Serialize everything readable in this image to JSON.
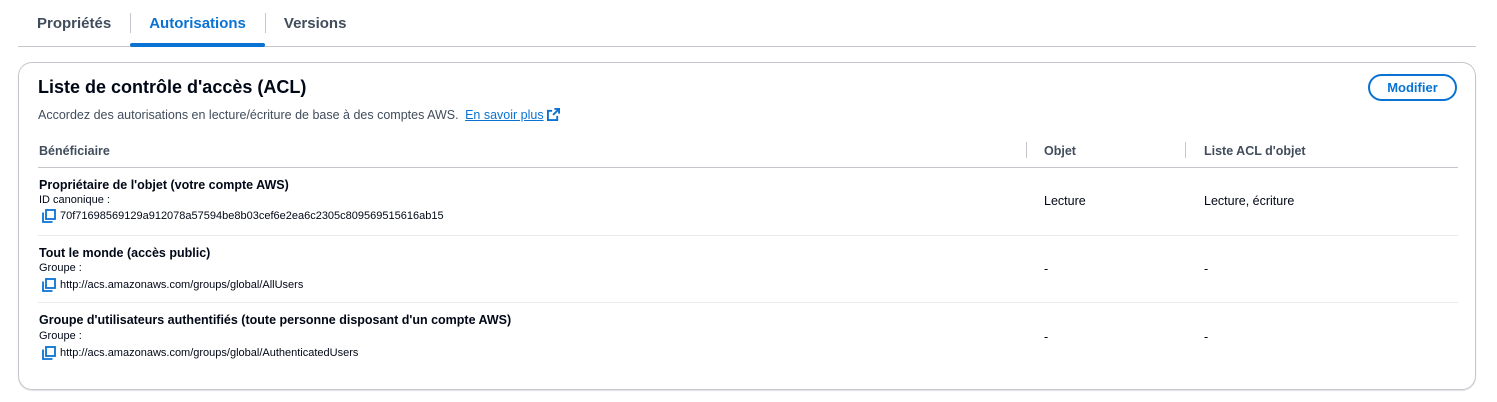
{
  "tabs": [
    "Propriétés",
    "Autorisations",
    "Versions"
  ],
  "active_tab": "Autorisations",
  "panel": {
    "title": "Liste de contrôle d'accès (ACL)",
    "description": "Accordez des autorisations en lecture/écriture de base à des comptes AWS.",
    "learn_more": "En savoir plus",
    "modify_label": "Modifier"
  },
  "table": {
    "headers": [
      "Bénéficiaire",
      "Objet",
      "Liste ACL d'objet"
    ],
    "rows": [
      {
        "grantee": "Propriétaire de l'objet (votre compte AWS)",
        "id_label": "ID canonique :",
        "id_value": "70f71698569129a912078a57594be8b03cef6e2ea6c2305c809569515616ab15",
        "object": "Lecture",
        "object_acl": "Lecture, écriture"
      },
      {
        "grantee": "Tout le monde (accès public)",
        "id_label": "Groupe :",
        "id_value": "http://acs.amazonaws.com/groups/global/AllUsers",
        "object": "-",
        "object_acl": "-"
      },
      {
        "grantee": "Groupe d'utilisateurs authentifiés (toute personne disposant d'un compte AWS)",
        "id_label": "Groupe :",
        "id_value": "http://acs.amazonaws.com/groups/global/AuthenticatedUsers",
        "object": "-",
        "object_acl": "-"
      }
    ]
  },
  "colors": {
    "accent": "#0972d3",
    "text": "#000716",
    "muted": "#414d5c",
    "border": "#c6c6cd"
  },
  "icons": {
    "copy": "copy-icon",
    "external_link": "external-link-icon"
  }
}
